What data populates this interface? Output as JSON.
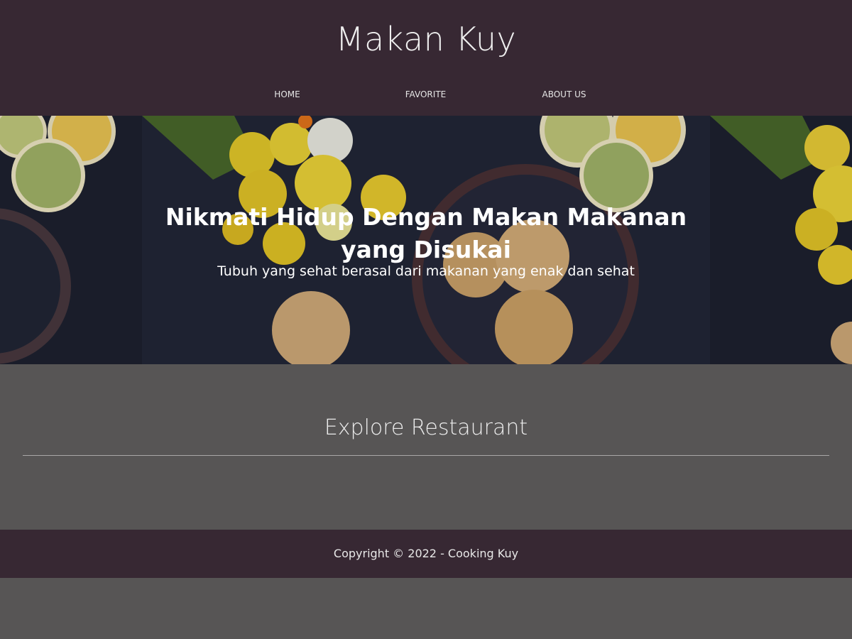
{
  "header": {
    "brand": "Makan Kuy",
    "nav": [
      {
        "label": "HOME"
      },
      {
        "label": "FAVORITE"
      },
      {
        "label": "ABOUT US"
      }
    ]
  },
  "hero": {
    "title": "Nikmati Hidup Dengan Makan Makanan yang Disukai",
    "subtitle": "Tubuh yang sehat berasal dari makanan yang enak dan sehat"
  },
  "main": {
    "section_title": "Explore Restaurant"
  },
  "footer": {
    "copyright": "Copyright © 2022 - Cooking Kuy"
  },
  "colors": {
    "header_bg": "#372833",
    "page_bg": "#575555",
    "footer_bg": "#372833"
  }
}
